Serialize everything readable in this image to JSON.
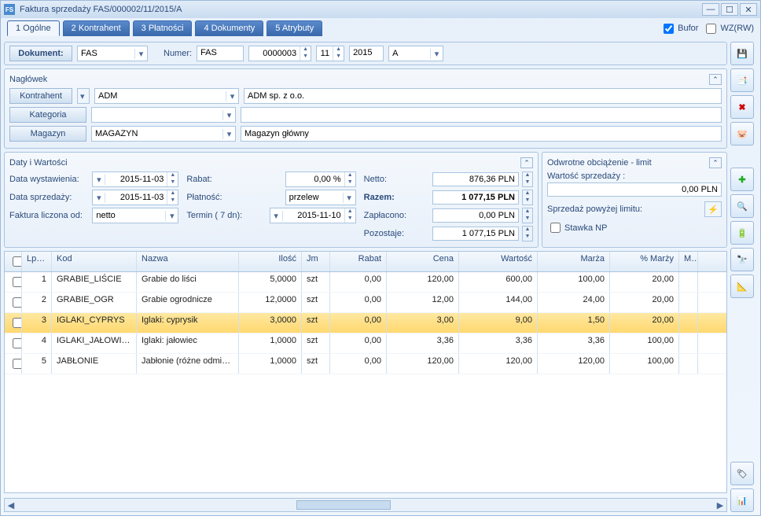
{
  "window": {
    "title": "Faktura sprzedaży FAS/000002/11/2015/A"
  },
  "tabs": [
    {
      "label": "1 Ogólne"
    },
    {
      "label": "2 Kontrahent"
    },
    {
      "label": "3 Płatności"
    },
    {
      "label": "4 Dokumenty"
    },
    {
      "label": "5 Atrybuty"
    }
  ],
  "top_checks": {
    "bufor": "Bufor",
    "wzrw": "WZ(RW)"
  },
  "doc": {
    "label": "Dokument:",
    "type": "FAS",
    "numer_label": "Numer:",
    "numer_prefix": "FAS",
    "numer_seq": "0000003",
    "numer_mm": "11",
    "numer_yyyy": "2015",
    "numer_suffix": "A"
  },
  "header": {
    "title": "Nagłówek",
    "kontrahent_label": "Kontrahent",
    "kontrahent_code": "ADM",
    "kontrahent_name": "ADM sp. z o.o.",
    "kategoria_label": "Kategoria",
    "kategoria_value": "",
    "magazyn_label": "Magazyn",
    "magazyn_code": "MAGAZYN",
    "magazyn_name": "Magazyn główny"
  },
  "dates_values": {
    "title": "Daty i Wartości",
    "data_wyst_label": "Data wystawienia:",
    "data_wyst": "2015-11-03",
    "data_sprz_label": "Data sprzedaży:",
    "data_sprz": "2015-11-03",
    "liczona_label": "Faktura liczona od:",
    "liczona": "netto",
    "rabat_label": "Rabat:",
    "rabat": "0,00 %",
    "platnosc_label": "Płatność:",
    "platnosc": "przelew",
    "termin_label": "Termin   (   7 dn):",
    "termin": "2015-11-10",
    "netto_label": "Netto:",
    "netto": "876,36 PLN",
    "razem_label": "Razem:",
    "razem": "1 077,15 PLN",
    "zaplacono_label": "Zapłacono:",
    "zaplacono": "0,00 PLN",
    "pozostaje_label": "Pozostaje:",
    "pozostaje": "1 077,15 PLN"
  },
  "reverse_charge": {
    "title": "Odwrotne obciążenie - limit",
    "wart_sprz_label": "Wartość sprzedaży :",
    "wart_sprz": "0,00 PLN",
    "sprzedaz_powyzej_label": "Sprzedaż powyżej limitu:",
    "stawka_np_label": "Stawka NP"
  },
  "grid": {
    "headers": {
      "lp": "Lp. ▲",
      "kod": "Kod",
      "nazwa": "Nazwa",
      "ilosc": "Ilość",
      "jm": "Jm",
      "rabat": "Rabat",
      "cena": "Cena",
      "wartosc": "Wartość",
      "marza": "Marża",
      "pmarzy": "% Marży",
      "ma": "Ma"
    },
    "rows": [
      {
        "lp": "1",
        "kod": "GRABIE_LIŚCIE",
        "nazwa": "Grabie do liści",
        "ilosc": "5,0000",
        "jm": "szt",
        "rabat": "0,00",
        "cena": "120,00",
        "wartosc": "600,00",
        "marza": "100,00",
        "pmarzy": "20,00"
      },
      {
        "lp": "2",
        "kod": "GRABIE_OGR",
        "nazwa": "Grabie ogrodnicze",
        "ilosc": "12,0000",
        "jm": "szt",
        "rabat": "0,00",
        "cena": "12,00",
        "wartosc": "144,00",
        "marza": "24,00",
        "pmarzy": "20,00"
      },
      {
        "lp": "3",
        "kod": "IGLAKI_CYPRYS",
        "nazwa": "Iglaki: cyprysik",
        "ilosc": "3,0000",
        "jm": "szt",
        "rabat": "0,00",
        "cena": "3,00",
        "wartosc": "9,00",
        "marza": "1,50",
        "pmarzy": "20,00",
        "selected": true
      },
      {
        "lp": "4",
        "kod": "IGLAKI_JAŁOWIEC",
        "nazwa": "Iglaki: jałowiec",
        "ilosc": "1,0000",
        "jm": "szt",
        "rabat": "0,00",
        "cena": "3,36",
        "wartosc": "3,36",
        "marza": "3,36",
        "pmarzy": "100,00"
      },
      {
        "lp": "5",
        "kod": "JABŁONIE",
        "nazwa": "Jabłonie (różne odmia...",
        "ilosc": "1,0000",
        "jm": "szt",
        "rabat": "0,00",
        "cena": "120,00",
        "wartosc": "120,00",
        "marza": "120,00",
        "pmarzy": "100,00"
      }
    ]
  },
  "toolbar_icons": {
    "save": "💾",
    "bookmark": "📑",
    "close": "✖",
    "piggy": "🐷",
    "add": "✚",
    "search": "🔍",
    "battery": "🔋",
    "binoc": "🔭",
    "calc": "📐",
    "tag": "🏷",
    "chart": "📊"
  }
}
